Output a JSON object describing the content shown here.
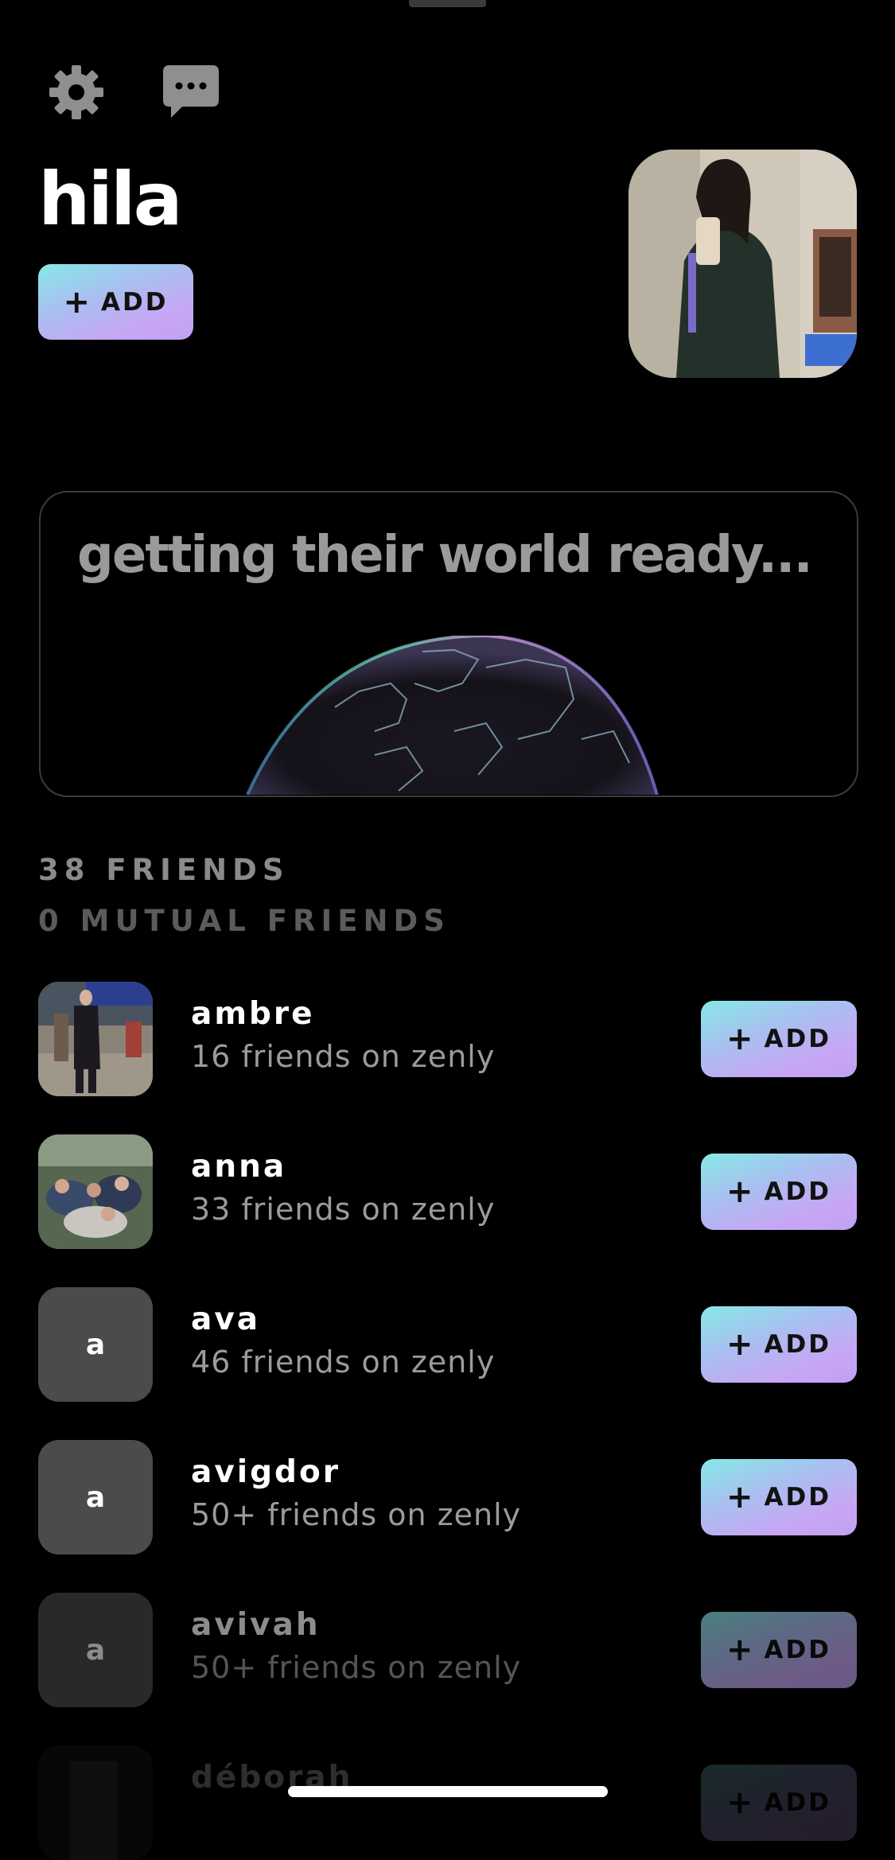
{
  "profile": {
    "name": "hila",
    "add_label": "ADD"
  },
  "icons": {
    "settings": "gear-icon",
    "messages": "chat-bubble-icon"
  },
  "world_card": {
    "text": "getting their world ready..."
  },
  "friends": {
    "count_label": "38 FRIENDS",
    "mutual_label": "0 MUTUAL FRIENDS",
    "items": [
      {
        "name": "ambre",
        "sub": "16 friends on zenly",
        "avatar": "photo",
        "add_label": "ADD"
      },
      {
        "name": "anna",
        "sub": "33 friends on zenly",
        "avatar": "photo",
        "add_label": "ADD"
      },
      {
        "name": "ava",
        "sub": "46 friends on zenly",
        "avatar_letter": "a",
        "add_label": "ADD"
      },
      {
        "name": "avigdor",
        "sub": "50+ friends on zenly",
        "avatar_letter": "a",
        "add_label": "ADD"
      },
      {
        "name": "avivah",
        "sub": "50+ friends on zenly",
        "avatar_letter": "a",
        "add_label": "ADD"
      },
      {
        "name": "déborah",
        "sub": "",
        "avatar": "photo",
        "add_label": "ADD"
      }
    ]
  },
  "colors": {
    "background": "#000000",
    "button_gradient_start": "#86e9e7",
    "button_gradient_end": "#c0a2f2",
    "muted_text": "#9b9b9b"
  }
}
